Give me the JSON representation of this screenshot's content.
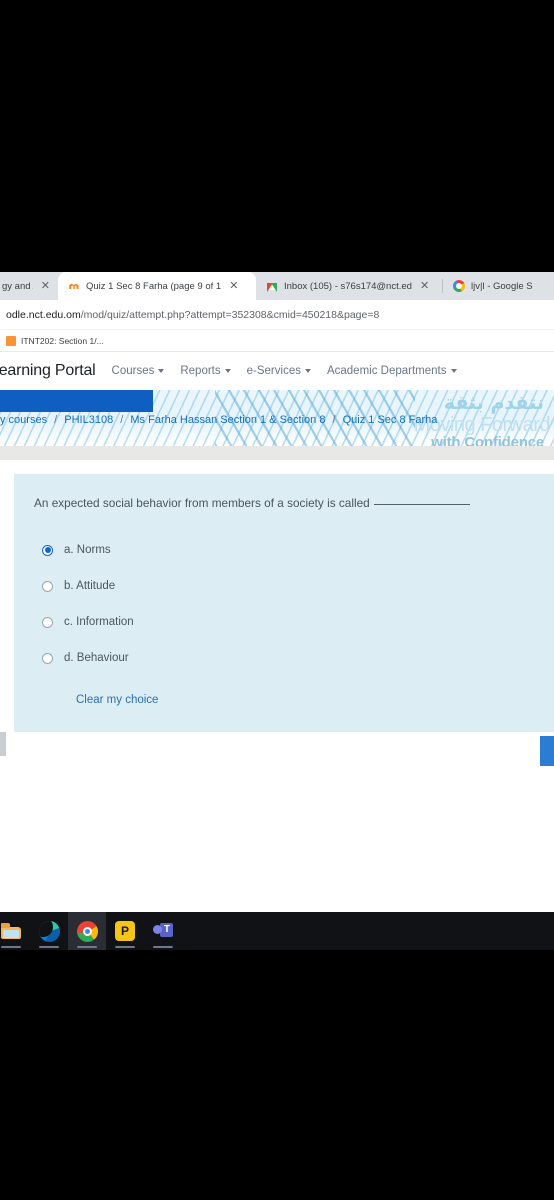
{
  "browser": {
    "tabs": [
      {
        "title": "gy and A",
        "favicon": "none",
        "active": false,
        "has_close": true
      },
      {
        "title": "Quiz 1 Sec 8 Farha (page 9 of 1",
        "favicon": "moodle-icon",
        "active": true,
        "has_close": true
      },
      {
        "title": "Inbox (105) - s76s174@nct.ed",
        "favicon": "gmail-icon",
        "active": false,
        "has_close": true
      },
      {
        "title": "ljv|l - Google S",
        "favicon": "google-icon",
        "active": false,
        "has_close": false
      }
    ],
    "close_glyph": "✕",
    "url_domain": "odle.nct.edu.om",
    "url_path": "/mod/quiz/attempt.php?attempt=352308&cmid=450218&page=8",
    "bookmarks": [
      {
        "label": "ITNT202: Section 1/..."
      }
    ]
  },
  "nav": {
    "brand": "Learning Portal",
    "items": [
      {
        "label": "Courses",
        "has_caret": true
      },
      {
        "label": "Reports",
        "has_caret": true
      },
      {
        "label": "e-Services",
        "has_caret": true
      },
      {
        "label": "Academic Departments",
        "has_caret": true
      }
    ]
  },
  "banner": {
    "arabic": "نتقدم بثقة",
    "english_line1": "Moving Forward",
    "english_line2": "with Confidence"
  },
  "breadcrumb": {
    "separator": "/",
    "items": [
      {
        "label": "y courses"
      },
      {
        "label": "PHIL3108"
      },
      {
        "label": "Ms Farha Hassan Section 1 & Section 8"
      },
      {
        "label": "Quiz 1 Sec 8 Farha"
      }
    ]
  },
  "question": {
    "text": "An expected social behavior from members of a society is called",
    "options": [
      {
        "label": "a. Norms",
        "selected": true
      },
      {
        "label": "b. Attitude",
        "selected": false
      },
      {
        "label": "c. Information",
        "selected": false
      },
      {
        "label": "d. Behaviour",
        "selected": false
      }
    ],
    "clear_label": "Clear my choice"
  },
  "taskbar": {
    "items": [
      {
        "name": "file-explorer-icon",
        "active": false,
        "running": true
      },
      {
        "name": "edge-icon",
        "active": false,
        "running": true
      },
      {
        "name": "chrome-icon",
        "active": true,
        "running": true
      },
      {
        "name": "yellow-app-icon",
        "active": false,
        "running": true
      },
      {
        "name": "teams-icon",
        "active": false,
        "running": true
      }
    ]
  },
  "colors": {
    "accent_blue": "#0f63d6",
    "link_blue": "#0f6fc5",
    "card_bg": "#ddedf4",
    "banner_blue": "#0f5fc2",
    "next_button": "#2b7cd3"
  }
}
